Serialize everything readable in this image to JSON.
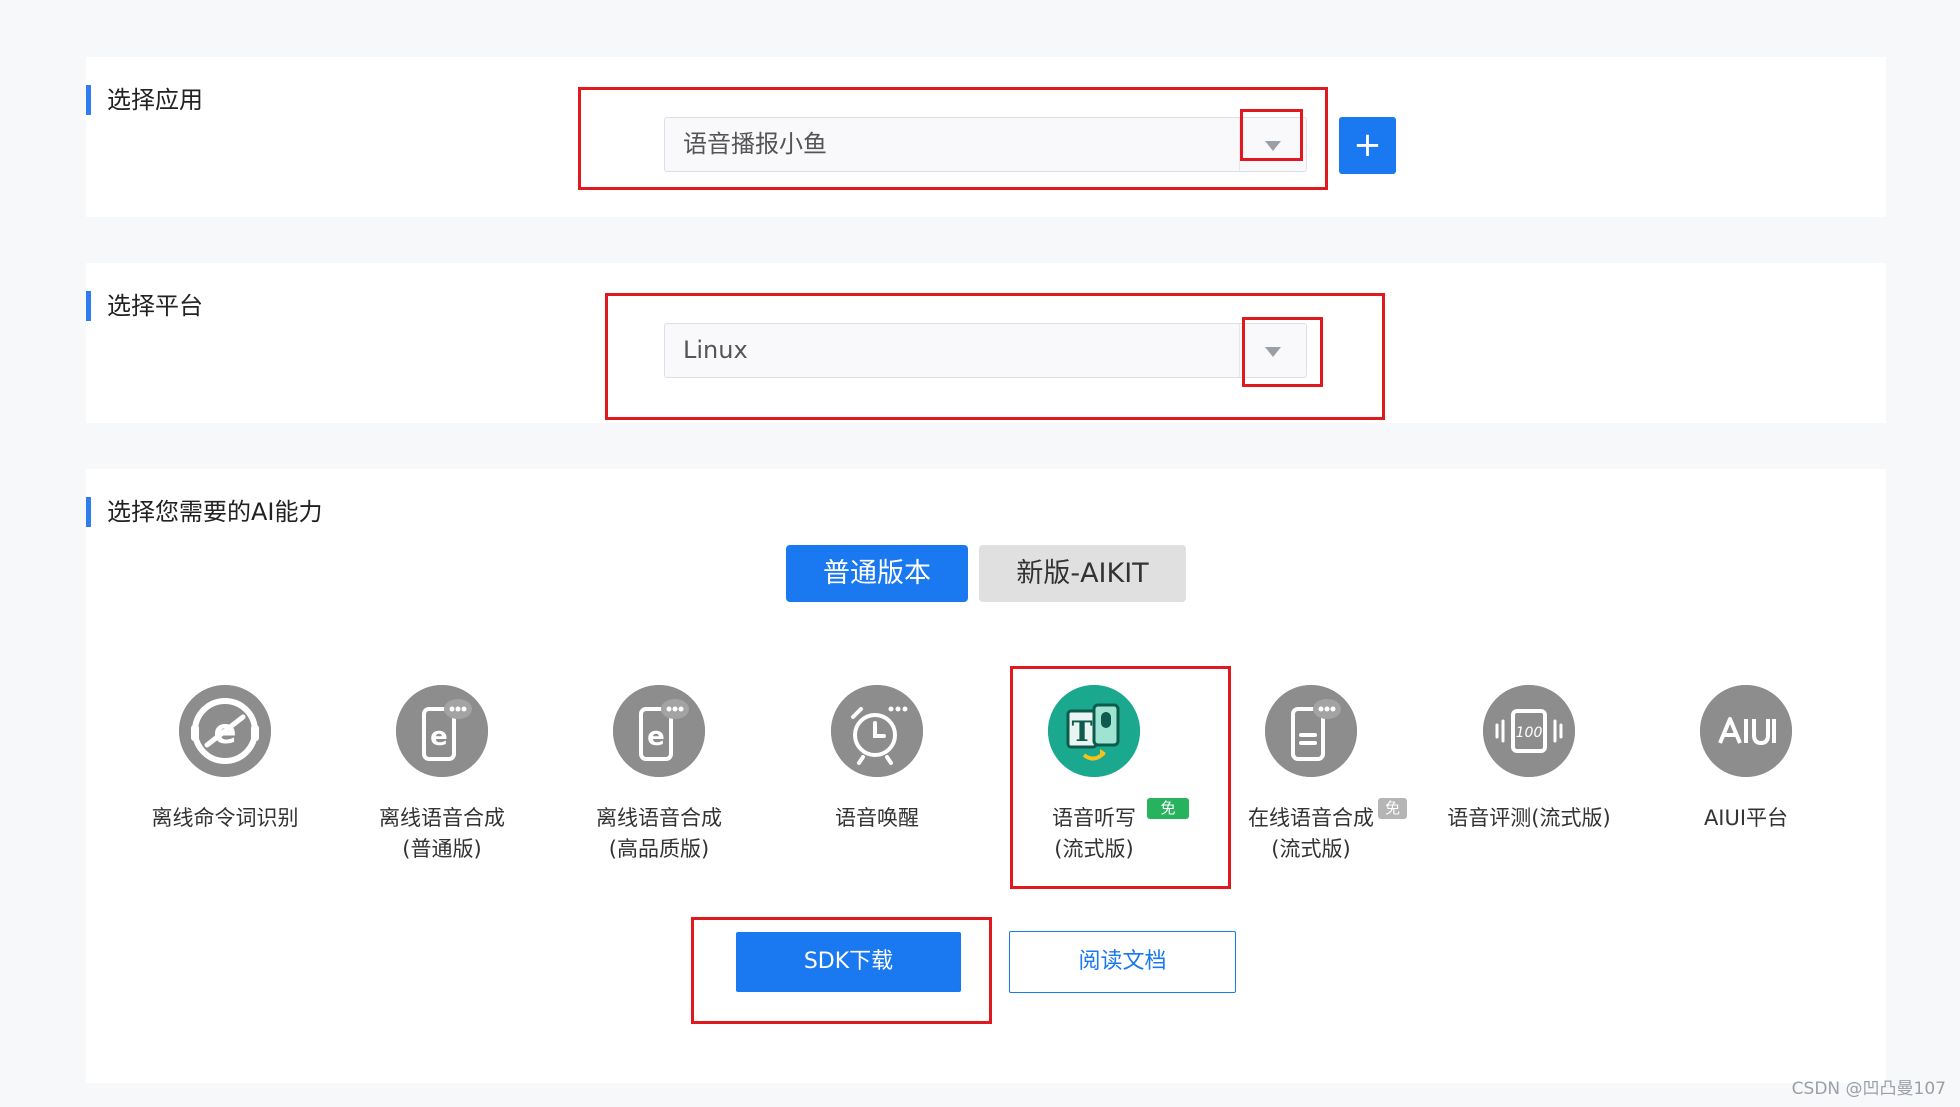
{
  "sections": {
    "app": {
      "title": "选择应用",
      "selected_value": "语音播报小鱼",
      "add_label": "+"
    },
    "platform": {
      "title": "选择平台",
      "selected_value": "Linux"
    },
    "ai": {
      "title": "选择您需要的AI能力",
      "tabs": [
        {
          "label": "普通版本",
          "active": true
        },
        {
          "label": "新版-AIKIT",
          "active": false
        }
      ],
      "capabilities": [
        {
          "label": "离线命令词识别",
          "icon": "offline-command-icon"
        },
        {
          "label": "离线语音合成\n(普通版)",
          "icon": "offline-tts-icon"
        },
        {
          "label": "离线语音合成\n(高品质版)",
          "icon": "offline-tts-hq-icon"
        },
        {
          "label": "语音唤醒",
          "icon": "wake-alarm-icon"
        },
        {
          "label": "语音听写\n(流式版)",
          "icon": "dictation-icon",
          "badge": "免费",
          "selected": true
        },
        {
          "label": "在线语音合成\n(流式版)",
          "icon": "online-tts-icon",
          "badge": "免费"
        },
        {
          "label": "语音评测(流式版)",
          "icon": "evaluation-icon"
        },
        {
          "label": "AIUI平台",
          "icon": "aiui-icon"
        }
      ],
      "sdk_button": "SDK下载",
      "docs_button": "阅读文档"
    }
  },
  "colors": {
    "accent": "#1a78f0",
    "highlight_box": "#e0191e",
    "active_icon": "#1aa88e",
    "free_badge_active": "#27b25d",
    "free_badge_inactive": "#b5b5b5"
  },
  "watermark": "CSDN @凹凸曼107"
}
